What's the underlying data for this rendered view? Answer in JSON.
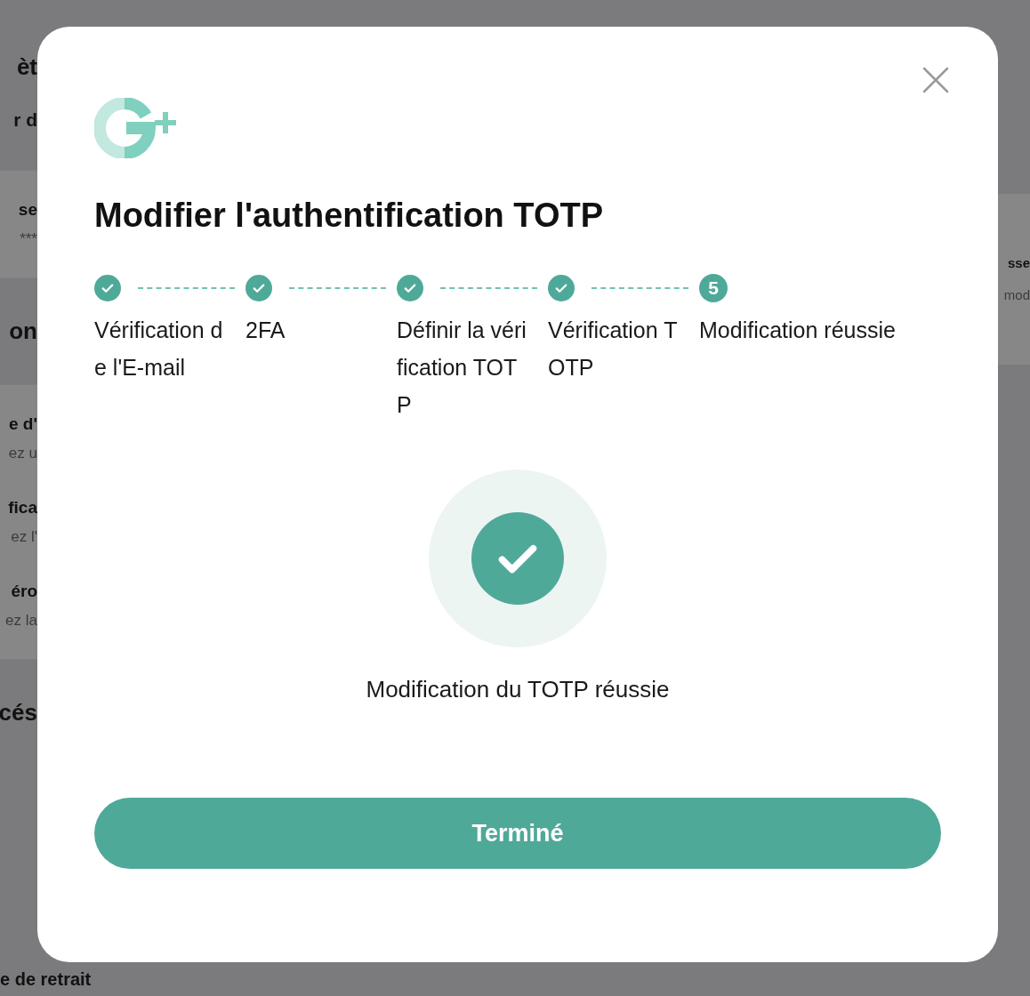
{
  "background": {
    "left_sections": [
      {
        "kind": "plain",
        "rows": [
          {
            "title": "èt",
            "kind": "heading"
          },
          {
            "title": "r d",
            "kind": "subheading"
          }
        ]
      },
      {
        "kind": "band",
        "rows": [
          {
            "title": "se",
            "subtitle": "***"
          }
        ]
      },
      {
        "kind": "plain",
        "rows": [
          {
            "title": "on",
            "kind": "heading"
          }
        ]
      },
      {
        "kind": "band",
        "rows": [
          {
            "title": "e d'",
            "subtitle": "ez u"
          },
          {
            "title": "fica",
            "subtitle": "ez l'"
          },
          {
            "title": "éro",
            "subtitle": "ez la"
          }
        ]
      },
      {
        "kind": "plain",
        "rows": [
          {
            "title": "cés",
            "kind": "heading"
          }
        ]
      }
    ],
    "bottom_text": "e de retrait",
    "right_rows": [
      {
        "title": "sse",
        "subtitle": "mod"
      }
    ]
  },
  "dialog": {
    "title": "Modifier l'authentification TOTP",
    "steps": [
      {
        "label": "Vérification de l'E-mail",
        "done": true
      },
      {
        "label": "2FA",
        "done": true
      },
      {
        "label": "Définir la vérification TOTP",
        "done": true
      },
      {
        "label": "Vérification TOTP",
        "done": true
      },
      {
        "label": "Modification réussie",
        "done": false,
        "number": "5"
      }
    ],
    "message": "Modification du TOTP réussie",
    "button": "Terminé"
  }
}
